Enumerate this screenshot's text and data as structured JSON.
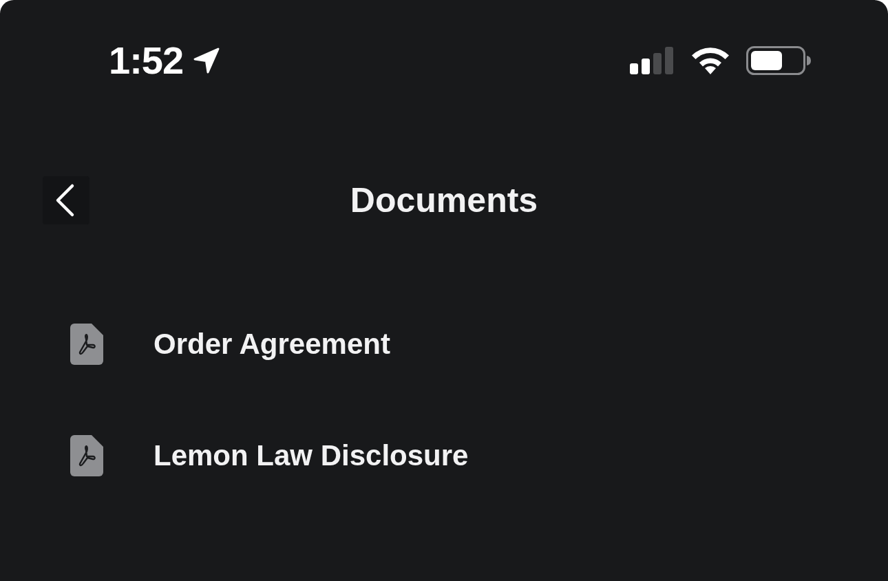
{
  "status_bar": {
    "time": "1:52"
  },
  "header": {
    "title": "Documents"
  },
  "documents": [
    {
      "name": "Order Agreement"
    },
    {
      "name": "Lemon Law Disclosure"
    }
  ]
}
